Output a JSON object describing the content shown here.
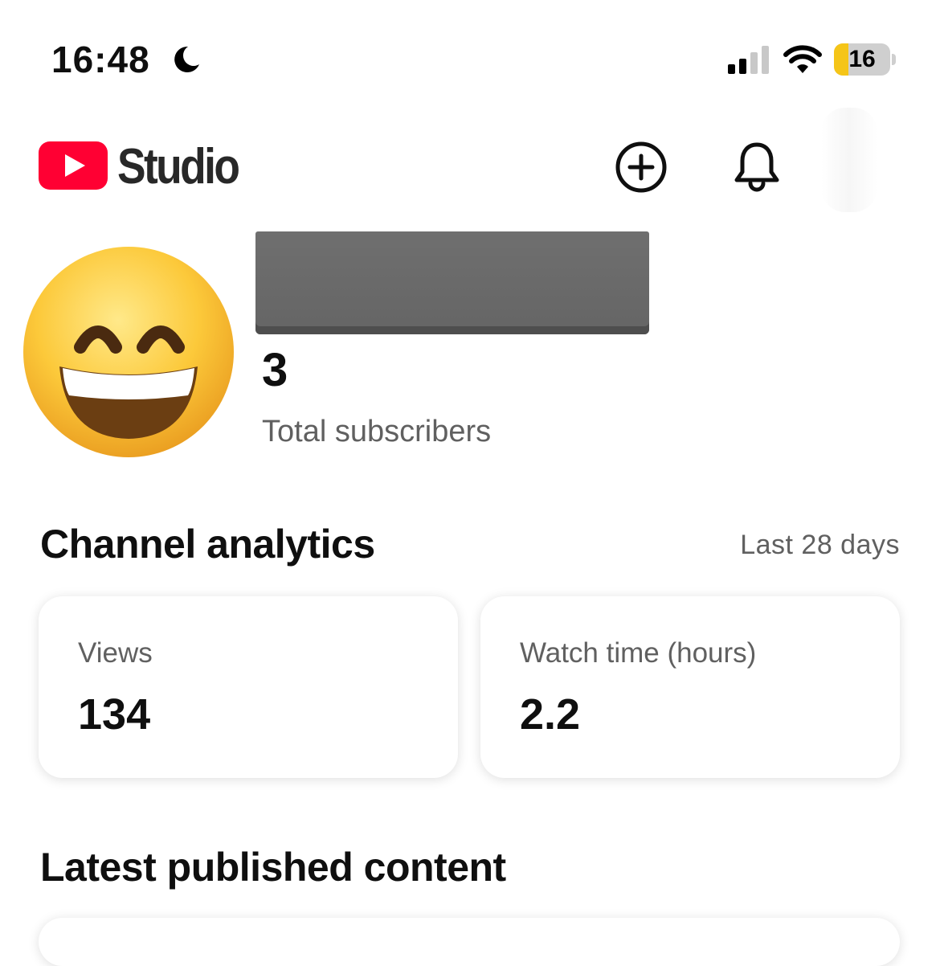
{
  "status_bar": {
    "time": "16:48",
    "focus_icon": "moon-icon",
    "signal_icon": "cellular-signal-icon",
    "wifi_icon": "wifi-icon",
    "battery_level": "16",
    "battery_fraction": 0.16,
    "battery_color": "#f5c518"
  },
  "header": {
    "logo_icon": "youtube-logo-icon",
    "app_name": "Studio",
    "create_icon": "create-plus-icon",
    "notifications_icon": "bell-icon",
    "brand_color": "#ff0033"
  },
  "channel": {
    "avatar_icon": "grinning-face-emoji",
    "subscriber_count": "3",
    "subscriber_label": "Total subscribers"
  },
  "analytics": {
    "title": "Channel analytics",
    "period": "Last 28 days",
    "cards": [
      {
        "label": "Views",
        "value": "134"
      },
      {
        "label": "Watch time (hours)",
        "value": "2.2"
      }
    ]
  },
  "latest": {
    "title": "Latest published content"
  }
}
